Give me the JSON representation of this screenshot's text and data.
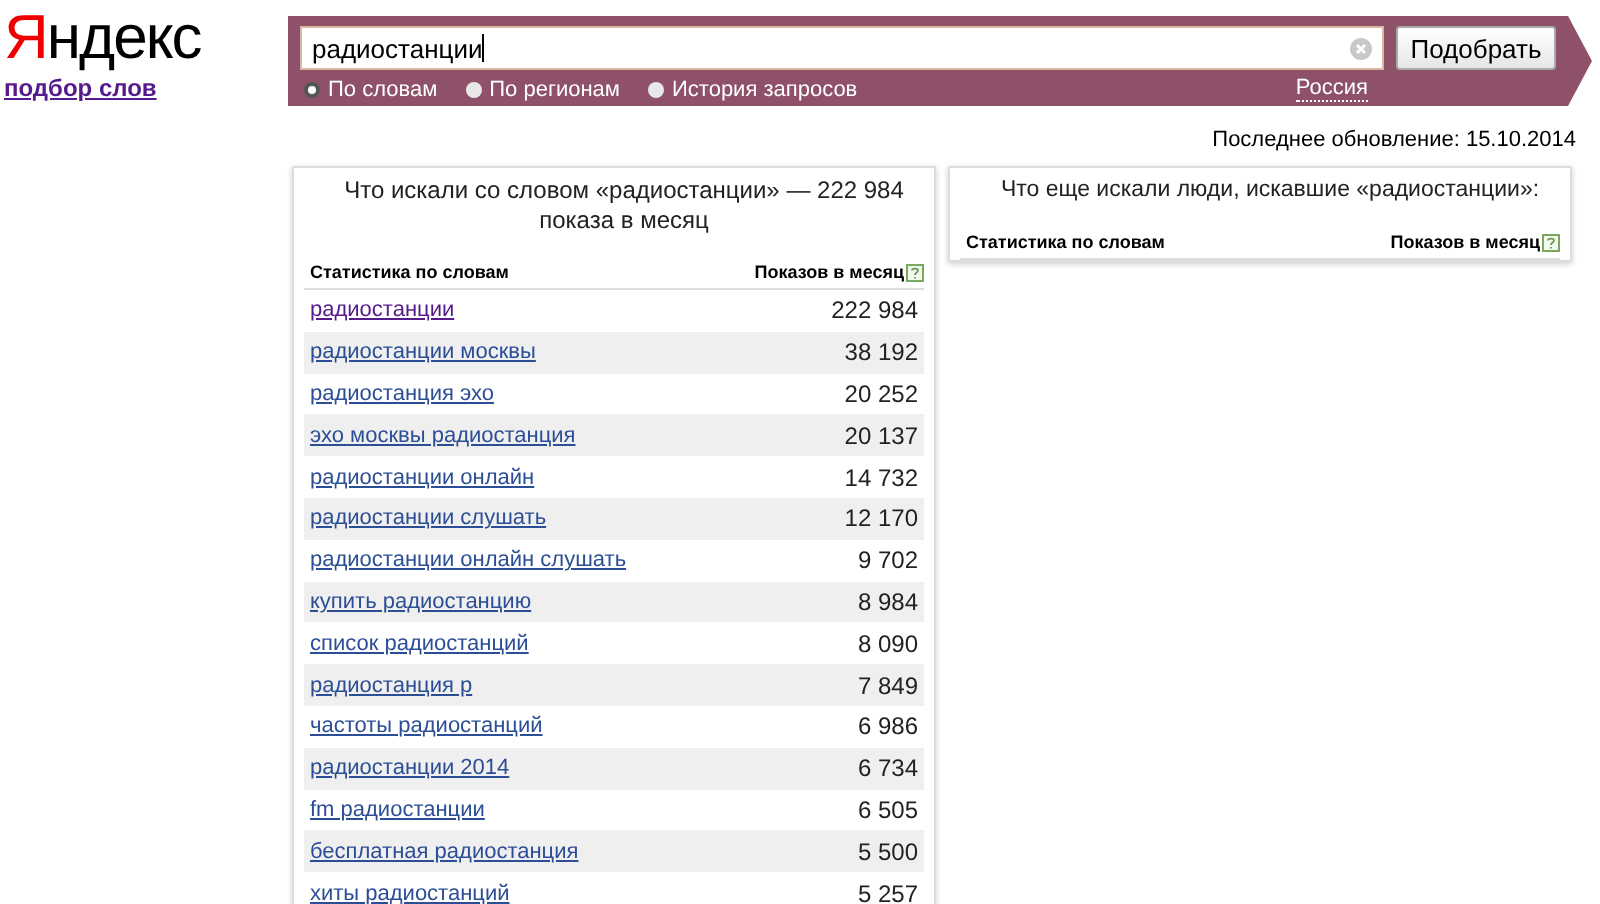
{
  "logo": {
    "first_letter": "Я",
    "rest": "ндекс",
    "subtitle": "подбор слов"
  },
  "search": {
    "value": "радиостанции",
    "button": "Подобрать",
    "region": "Россия",
    "modes": [
      {
        "label": "По словам",
        "selected": true
      },
      {
        "label": "По регионам",
        "selected": false
      },
      {
        "label": "История запросов",
        "selected": false
      }
    ]
  },
  "last_update": "Последнее обновление: 15.10.2014",
  "left_panel": {
    "title": "Что искали со словом «радиостанции» — 222 984 показа в месяц",
    "columns": [
      "Статистика по словам",
      "Показов в месяц"
    ],
    "rows": [
      {
        "phrase": "радиостанции",
        "count": "222 984",
        "visited": true
      },
      {
        "phrase": "радиостанции москвы",
        "count": "38 192",
        "visited": false
      },
      {
        "phrase": "радиостанция эхо",
        "count": "20 252",
        "visited": false
      },
      {
        "phrase": "эхо москвы радиостанция",
        "count": "20 137",
        "visited": false
      },
      {
        "phrase": "радиостанции онлайн",
        "count": "14 732",
        "visited": false
      },
      {
        "phrase": "радиостанции слушать",
        "count": "12 170",
        "visited": false
      },
      {
        "phrase": "радиостанции онлайн слушать",
        "count": "9 702",
        "visited": false
      },
      {
        "phrase": "купить радиостанцию",
        "count": "8 984",
        "visited": false
      },
      {
        "phrase": "список радиостанций",
        "count": "8 090",
        "visited": false
      },
      {
        "phrase": "радиостанция р",
        "count": "7 849",
        "visited": false
      },
      {
        "phrase": "частоты радиостанций",
        "count": "6 986",
        "visited": false
      },
      {
        "phrase": "радиостанции 2014",
        "count": "6 734",
        "visited": false
      },
      {
        "phrase": "fm радиостанции",
        "count": "6 505",
        "visited": false
      },
      {
        "phrase": "бесплатная радиостанция",
        "count": "5 500",
        "visited": false
      },
      {
        "phrase": "хиты радиостанций",
        "count": "5 257",
        "visited": false
      }
    ]
  },
  "right_panel": {
    "title": "Что еще искали люди, искавшие «радиостанции»:",
    "columns": [
      "Статистика по словам",
      "Показов в месяц"
    ]
  }
}
